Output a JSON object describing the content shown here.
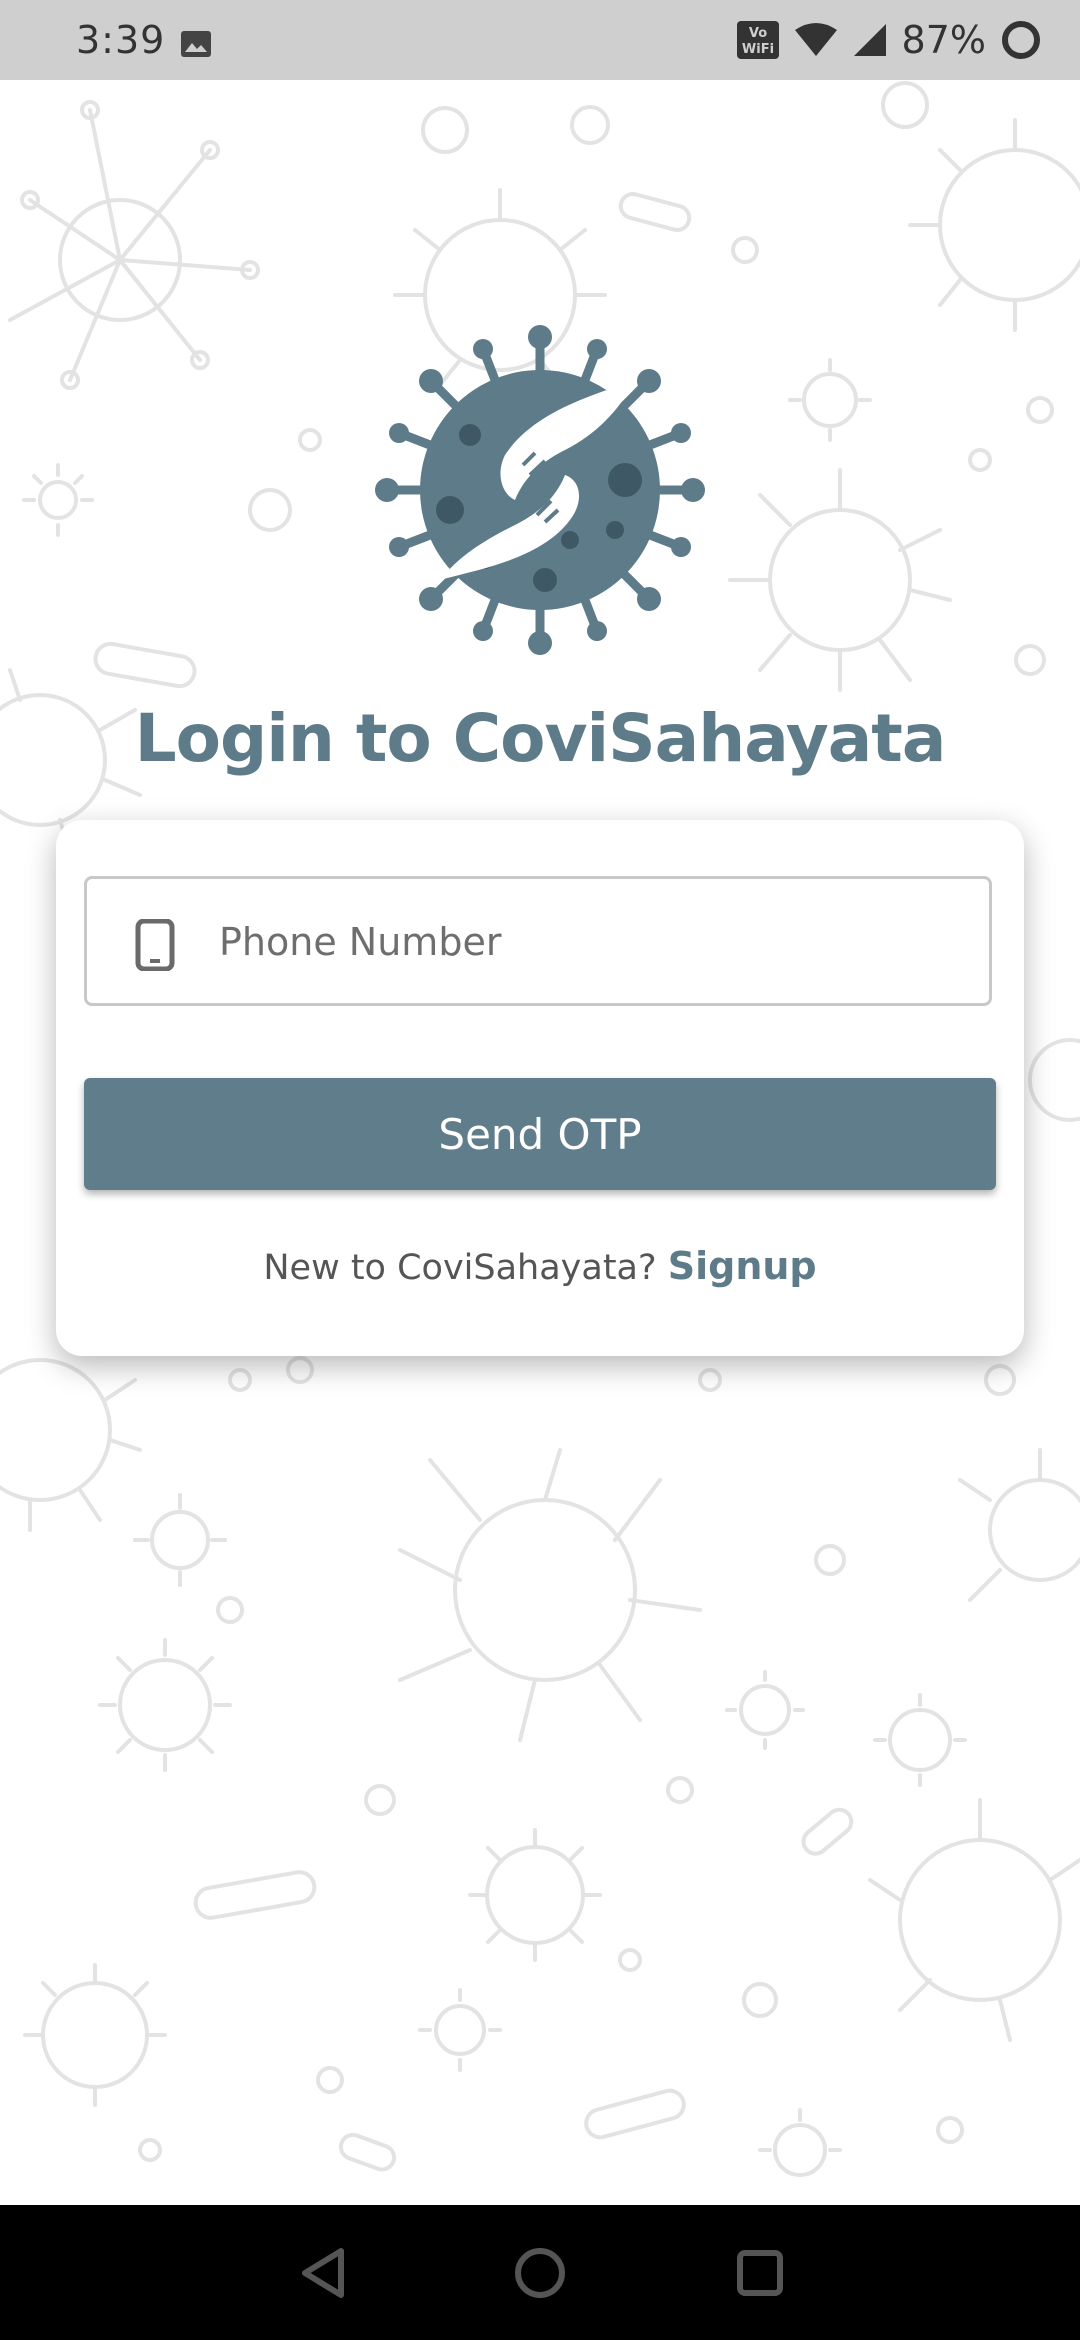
{
  "status_bar": {
    "time": "3:39",
    "battery": "87%",
    "icons": [
      "image-icon",
      "volte-wifi-icon",
      "wifi-icon",
      "signal-icon",
      "battery-icon"
    ]
  },
  "login": {
    "title": "Login to CoviSahayata",
    "phone_placeholder": "Phone Number",
    "phone_value": "",
    "send_otp_label": "Send OTP",
    "signup_prompt": "New to CoviSahayata?",
    "signup_link": "Signup"
  },
  "nav_bar": {
    "icons": [
      "back-icon",
      "home-icon",
      "recents-icon"
    ]
  },
  "colors": {
    "primary": "#607d8b",
    "title": "#5e7b8a",
    "status_bar_bg": "#cfcfcf",
    "nav_bar_bg": "#000000",
    "pattern_stroke": "#e3e3e3"
  }
}
